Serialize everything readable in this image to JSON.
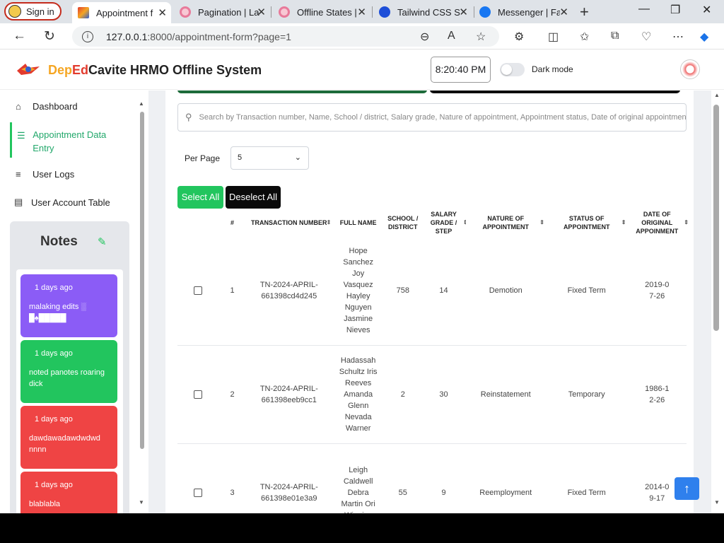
{
  "browser": {
    "signin_label": "Sign in",
    "tabs": [
      {
        "title": "Appointment f",
        "active": true
      },
      {
        "title": "Pagination | La",
        "active": false
      },
      {
        "title": "Offline States |",
        "active": false
      },
      {
        "title": "Tailwind CSS Sc",
        "active": false
      },
      {
        "title": "Messenger | Fa",
        "active": false
      }
    ],
    "url_host": "127.0.0.1",
    "url_path": ":8000/appointment-form?page=1"
  },
  "header": {
    "title_dep": "Dep",
    "title_ed": "Ed",
    "title_rest": "Cavite HRMO Offline System",
    "clock": "8:20:40 PM",
    "dark_mode_label": "Dark mode"
  },
  "sidebar": {
    "items": [
      {
        "label": "Dashboard",
        "icon": "home-icon"
      },
      {
        "label": "Appointment Data Entry",
        "icon": "list-ordered-icon"
      },
      {
        "label": "User Logs",
        "icon": "list-icon"
      },
      {
        "label": "User Account Table",
        "icon": "table-icon"
      }
    ],
    "notes_title": "Notes",
    "notes": [
      {
        "ago": "1 days ago",
        "text": "malaking edits ░ █♠█████",
        "color": "#8b5cf6"
      },
      {
        "ago": "1 days ago",
        "text": "noted panotes roaring dick",
        "color": "#22c55e"
      },
      {
        "ago": "1 days ago",
        "text": "dawdawadawdwdwd nnnn",
        "color": "#ef4444"
      },
      {
        "ago": "1 days ago",
        "text": "blablabla",
        "color": "#ef4444"
      }
    ]
  },
  "main": {
    "search_placeholder": "Search by Transaction number, Name, School / district, Salary grade, Nature of appointment, Appointment status, Date of original appointment",
    "per_page_label": "Per Page",
    "per_page_value": "5",
    "select_all": "Select All",
    "deselect_all": "Deselect All",
    "columns": [
      "#",
      "TRANSACTION NUMBER",
      "FULL NAME",
      "SCHOOL / DISTRICT",
      "SALARY GRADE / STEP",
      "NATURE OF APPOINTMENT",
      "STATUS OF APPOINTMENT",
      "DATE OF ORIGINAL APPOINMENT"
    ],
    "rows": [
      {
        "num": "1",
        "txn": "TN-2024-APRIL-661398cd4d245",
        "name": "Hope Sanchez Joy Vasquez Hayley Nguyen Jasmine Nieves",
        "school": "758",
        "grade": "14",
        "nature": "Demotion",
        "status": "Fixed Term",
        "date": "2019-07-26"
      },
      {
        "num": "2",
        "txn": "TN-2024-APRIL-661398eeb9cc1",
        "name": "Hadassah Schultz Iris Reeves Amanda Glenn Nevada Warner",
        "school": "2",
        "grade": "30",
        "nature": "Reinstatement",
        "status": "Temporary",
        "date": "1986-12-26"
      },
      {
        "num": "3",
        "txn": "TN-2024-APRIL-661398e01e3a9",
        "name": "Leigh Caldwell Debra Martin Ori Wiggins",
        "school": "55",
        "grade": "9",
        "nature": "Reemployment",
        "status": "Fixed Term",
        "date": "2014-09-17"
      }
    ]
  }
}
